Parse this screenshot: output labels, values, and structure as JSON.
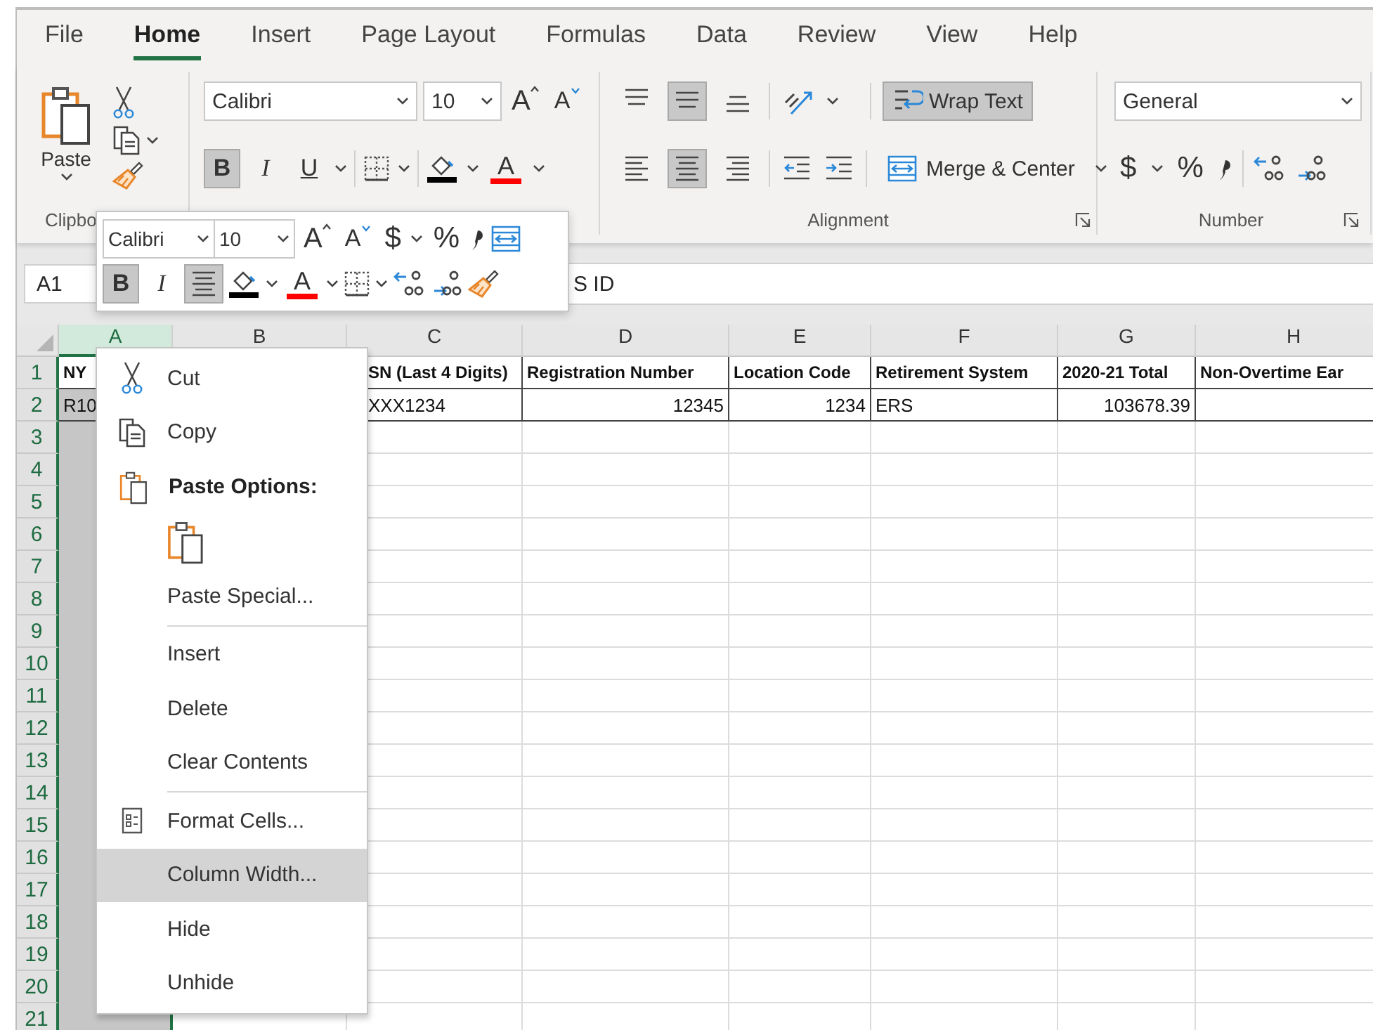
{
  "tabs": [
    {
      "label": "File",
      "selected": false
    },
    {
      "label": "Home",
      "selected": true
    },
    {
      "label": "Insert",
      "selected": false
    },
    {
      "label": "Page Layout",
      "selected": false
    },
    {
      "label": "Formulas",
      "selected": false
    },
    {
      "label": "Data",
      "selected": false
    },
    {
      "label": "Review",
      "selected": false
    },
    {
      "label": "View",
      "selected": false
    },
    {
      "label": "Help",
      "selected": false
    }
  ],
  "ribbon": {
    "clipboard": {
      "paste": "Paste",
      "label": "Clipbo"
    },
    "font": {
      "family": "Calibri",
      "size": "10",
      "grow": "A",
      "shrink": "A",
      "bold": {
        "text": "B",
        "on": true
      },
      "italic": {
        "text": "I",
        "on": false
      },
      "underline": {
        "text": "U",
        "on": false
      },
      "color_letter": "A"
    },
    "alignment": {
      "middle_on": true,
      "center_on": true,
      "wrap": {
        "text": "Wrap Text",
        "on": true
      },
      "merge": "Merge & Center",
      "label": "Alignment"
    },
    "number": {
      "format": "General",
      "currency": "$",
      "percent": "%",
      "label": "Number"
    }
  },
  "formula_bar": {
    "name_box": "A1",
    "content": "S ID"
  },
  "mini_toolbar": {
    "family": "Calibri",
    "size": "10",
    "grow": "A",
    "shrink": "A",
    "currency": "$",
    "percent": "%",
    "bold": {
      "text": "B",
      "on": true
    },
    "italic": {
      "text": "I",
      "on": false
    },
    "center_on": true,
    "color_letter": "A"
  },
  "sheet": {
    "columns": [
      {
        "letter": "A",
        "selected": true
      },
      {
        "letter": "B",
        "selected": false
      },
      {
        "letter": "C",
        "selected": false
      },
      {
        "letter": "D",
        "selected": false
      },
      {
        "letter": "E",
        "selected": false
      },
      {
        "letter": "F",
        "selected": false
      },
      {
        "letter": "G",
        "selected": false
      },
      {
        "letter": "H",
        "selected": false
      }
    ],
    "rows": [
      {
        "number": "1",
        "bold": true,
        "cells": [
          {
            "text": "NY"
          },
          {},
          {
            "text": "SN (Last 4 Digits)"
          },
          {
            "text": "Registration Number"
          },
          {
            "text": "Location Code"
          },
          {
            "text": "Retirement System"
          },
          {
            "text": "2020-21 Total"
          },
          {
            "text": "Non-Overtime Ear"
          }
        ]
      },
      {
        "number": "2",
        "bold": false,
        "cells": [
          {
            "text": "R10"
          },
          {},
          {
            "text": "XXX1234"
          },
          {
            "text": "12345",
            "kind": "number"
          },
          {
            "text": "1234",
            "kind": "number"
          },
          {
            "text": "ERS"
          },
          {
            "text": "103678.39",
            "kind": "number"
          },
          {}
        ]
      },
      {
        "number": "3"
      },
      {
        "number": "4"
      },
      {
        "number": "5"
      },
      {
        "number": "6"
      },
      {
        "number": "7"
      },
      {
        "number": "8"
      },
      {
        "number": "9"
      },
      {
        "number": "10"
      },
      {
        "number": "11"
      },
      {
        "number": "12"
      },
      {
        "number": "13"
      },
      {
        "number": "14"
      },
      {
        "number": "15"
      },
      {
        "number": "16"
      },
      {
        "number": "17"
      },
      {
        "number": "18"
      },
      {
        "number": "19"
      },
      {
        "number": "20"
      },
      {
        "number": "21"
      }
    ]
  },
  "context_menu": [
    {
      "kind": "cut",
      "label": "Cut",
      "selected": false
    },
    {
      "kind": "copy",
      "label": "Copy",
      "selected": false
    },
    {
      "kind": "header",
      "label": "Paste Options:"
    },
    {
      "kind": "paste",
      "selected": false
    },
    {
      "kind": "plain",
      "label": "Paste Special...",
      "selected": false
    },
    {
      "kind": "separator"
    },
    {
      "kind": "plain",
      "label": "Insert",
      "selected": false
    },
    {
      "kind": "plain",
      "label": "Delete",
      "selected": false
    },
    {
      "kind": "plain",
      "label": "Clear Contents",
      "selected": false
    },
    {
      "kind": "separator"
    },
    {
      "kind": "format",
      "label": "Format Cells...",
      "selected": false
    },
    {
      "kind": "plain",
      "label": "Column Width...",
      "selected": true
    },
    {
      "kind": "plain",
      "label": "Hide",
      "selected": false
    },
    {
      "kind": "plain",
      "label": "Unhide",
      "selected": false
    }
  ]
}
